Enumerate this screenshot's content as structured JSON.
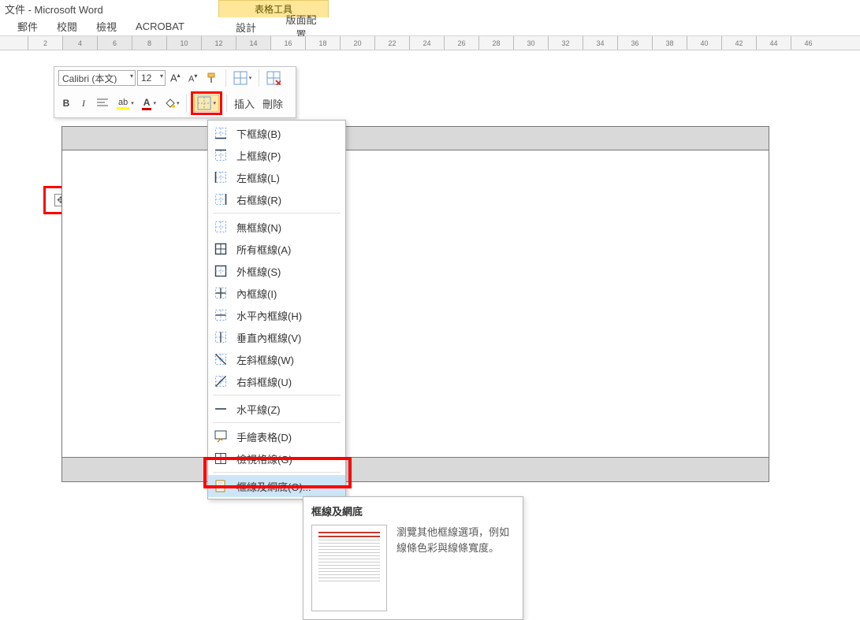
{
  "title_bar": "文件 - Microsoft Word",
  "tabs": {
    "mail": "郵件",
    "review": "校閱",
    "view": "檢視",
    "acrobat": "ACROBAT"
  },
  "contextual": {
    "header": "表格工具",
    "design": "設計",
    "layout": "版面配置"
  },
  "ruler_numbers": [
    "2",
    "4",
    "6",
    "8",
    "10",
    "12",
    "14",
    "16",
    "18",
    "20",
    "22",
    "24",
    "26",
    "28",
    "30",
    "32",
    "34",
    "36",
    "38",
    "40",
    "42",
    "44",
    "46"
  ],
  "ruler_shaded_upto_index": 7,
  "mini_toolbar": {
    "font_name": "Calibri (本文)",
    "font_size": "12",
    "insert": "插入",
    "delete": "刪除",
    "bold": "B",
    "italic": "I"
  },
  "border_menu": {
    "items": [
      {
        "key": "bottom",
        "label": "下框線(B)"
      },
      {
        "key": "top",
        "label": "上框線(P)"
      },
      {
        "key": "left",
        "label": "左框線(L)"
      },
      {
        "key": "right",
        "label": "右框線(R)"
      },
      {
        "key": "none",
        "label": "無框線(N)"
      },
      {
        "key": "all",
        "label": "所有框線(A)"
      },
      {
        "key": "outside",
        "label": "外框線(S)"
      },
      {
        "key": "inside",
        "label": "內框線(I)"
      },
      {
        "key": "inside_h",
        "label": "水平內框線(H)"
      },
      {
        "key": "inside_v",
        "label": "垂直內框線(V)"
      },
      {
        "key": "diag_down",
        "label": "左斜框線(W)"
      },
      {
        "key": "diag_up",
        "label": "右斜框線(U)"
      },
      {
        "key": "hline",
        "label": "水平線(Z)"
      },
      {
        "key": "draw",
        "label": "手繪表格(D)"
      },
      {
        "key": "gridlines",
        "label": "檢視格線(G)"
      },
      {
        "key": "dialog",
        "label": "框線及網底(O)..."
      }
    ]
  },
  "tooltip": {
    "title": "框線及網底",
    "desc": "瀏覽其他框線選項，例如線條色彩與線條寬度。"
  }
}
